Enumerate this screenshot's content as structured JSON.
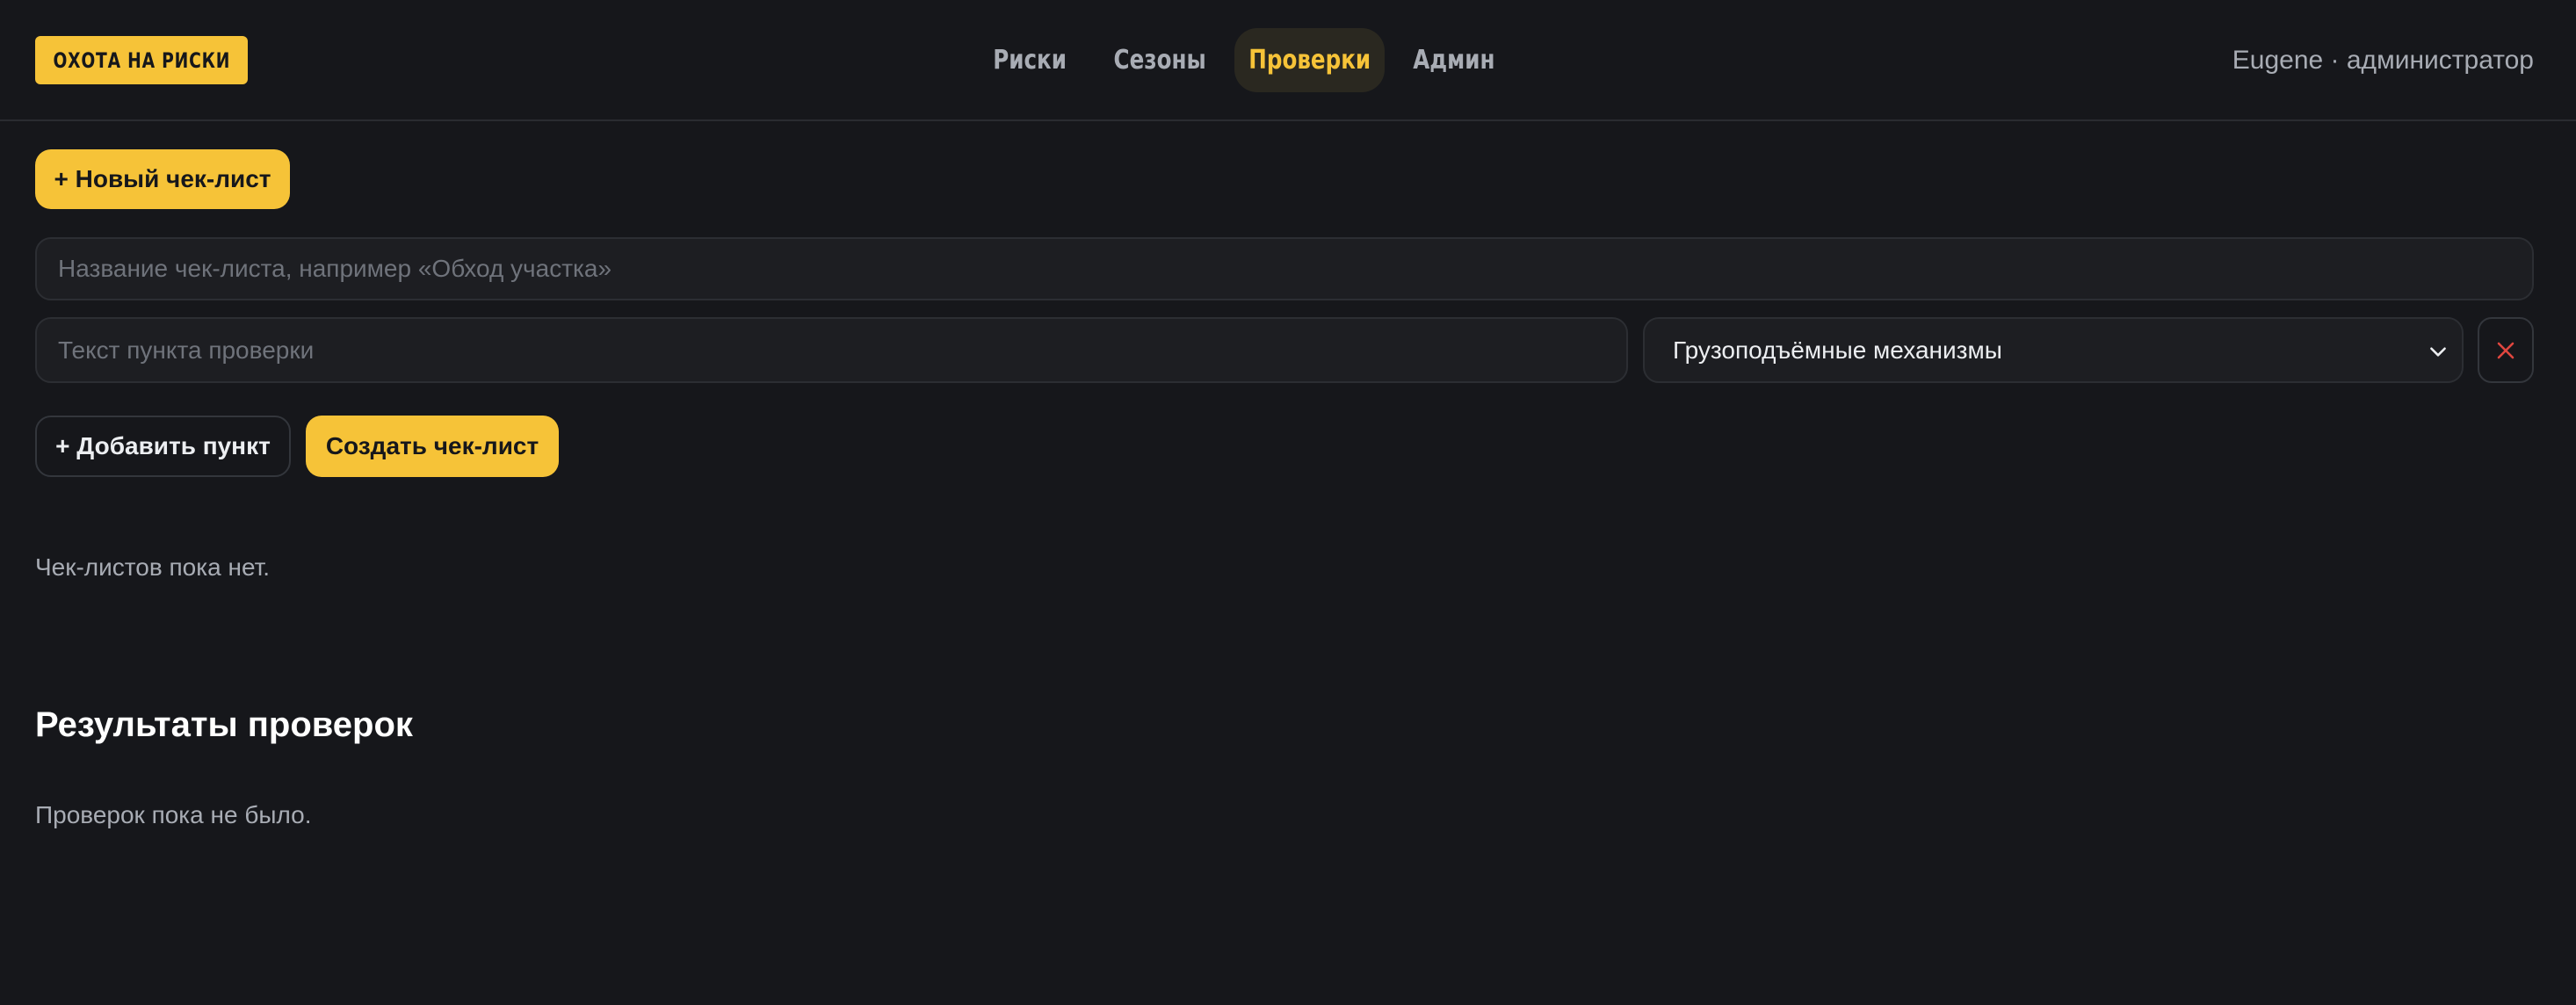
{
  "header": {
    "logo_text": "ОХОТА НА РИСКИ",
    "nav": {
      "risks": "Риски",
      "seasons": "Сезоны",
      "checks": "Проверки",
      "admin": "Админ"
    },
    "active_tab": "Проверки",
    "user_info": "Eugene · администратор"
  },
  "checklist_form": {
    "new_button_label": "+ Новый чек-лист",
    "title_placeholder": "Название чек-листа, например «Обход участка»",
    "item_placeholder": "Текст пункта проверки",
    "category_selected": "Грузоподъёмные механизмы",
    "add_item_label": "+ Добавить пункт",
    "create_label": "Создать чек-лист"
  },
  "checklists": {
    "empty_text": "Чек-листов пока нет."
  },
  "results": {
    "title": "Результаты проверок",
    "empty_text": "Проверок пока не было."
  },
  "colors": {
    "accent": "#f6c338",
    "background": "#16171b",
    "remove_icon": "#e0463f"
  },
  "icons": {
    "select_chevron": "chevron-down-icon",
    "remove": "close-icon"
  }
}
